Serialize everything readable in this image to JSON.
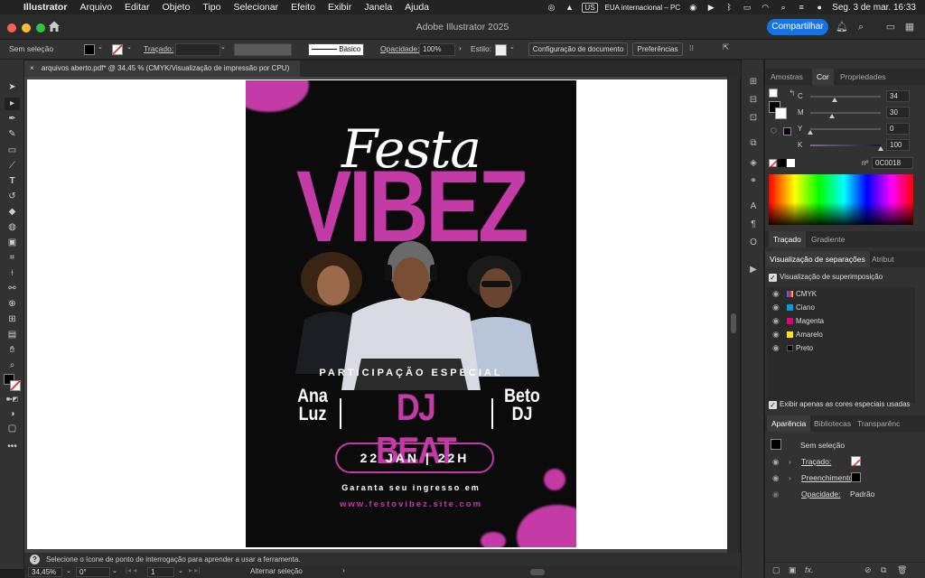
{
  "menubar": {
    "app": "Illustrator",
    "items": [
      "Arquivo",
      "Editar",
      "Objeto",
      "Tipo",
      "Selecionar",
      "Efeito",
      "Exibir",
      "Janela",
      "Ajuda"
    ],
    "input_source": "EUA internacional – PC",
    "flag": "US",
    "datetime": "Seg. 3 de mar.  16:33"
  },
  "titlebar": {
    "title": "Adobe Illustrator 2025",
    "share_label": "Compartilhar"
  },
  "controlbar": {
    "selection": "Sem seleção",
    "stroke_label": "Traçado:",
    "brush_label": "Básico",
    "opacity_label": "Opacidade:",
    "opacity_value": "100%",
    "style_label": "Estilo:",
    "doc_setup": "Configuração de documento",
    "preferences": "Preferências"
  },
  "doctab": {
    "label": "arquivos aberto.pdf* @ 34,45 % (CMYK/Visualização de impressão por CPU)"
  },
  "poster": {
    "festa": "Festa",
    "vibez": "VIBEZ",
    "participacao": "PARTICIPAÇÃO ESPECIAL",
    "left_name_1": "Ana",
    "left_name_2": "Luz",
    "dj": "DJ BEAT",
    "right_name_1": "Beto",
    "right_name_2": "DJ",
    "date": "22 JAN  |  22H",
    "garanta": "Garanta seu ingresso em",
    "site": "www.festovibez.site.com",
    "accent": "#c43aa6"
  },
  "color_panel": {
    "tabs": [
      "Amostras",
      "Cor",
      "Propriedades"
    ],
    "channels": [
      {
        "label": "C",
        "value": "34",
        "pct": 34
      },
      {
        "label": "M",
        "value": "30",
        "pct": 30
      },
      {
        "label": "Y",
        "value": "0",
        "pct": 0
      },
      {
        "label": "K",
        "value": "100",
        "pct": 100
      }
    ],
    "hex_prefix": "nº",
    "hex": "0C0018"
  },
  "stroke_panel": {
    "tabs": [
      "Traçado",
      "Gradiente"
    ]
  },
  "separations_panel": {
    "tabs": [
      "Visualização de separações",
      "Atribut"
    ],
    "overprint_label": "Visualização de superimposição",
    "rows": [
      {
        "name": "CMYK",
        "color": "#888888"
      },
      {
        "name": "Ciano",
        "color": "#00a0e0"
      },
      {
        "name": "Magenta",
        "color": "#e0007a"
      },
      {
        "name": "Amarelo",
        "color": "#ffe600"
      },
      {
        "name": "Preto",
        "color": "#000000"
      }
    ],
    "spot_label": "Exibir apenas as cores especiais usadas"
  },
  "appearance_panel": {
    "tabs": [
      "Aparência",
      "Bibliotecas",
      "Transparênc"
    ],
    "selection": "Sem seleção",
    "stroke_label": "Traçado:",
    "fill_label": "Preenchimento:",
    "opacity_label": "Opacidade:",
    "opacity_value": "Padrão"
  },
  "status": {
    "hint": "Selecione o ícone de ponto de interrogação para aprender a usar a ferramenta.",
    "zoom": "34,45%",
    "rotation": "0°",
    "artboard": "1",
    "mode": "Alternar seleção"
  }
}
